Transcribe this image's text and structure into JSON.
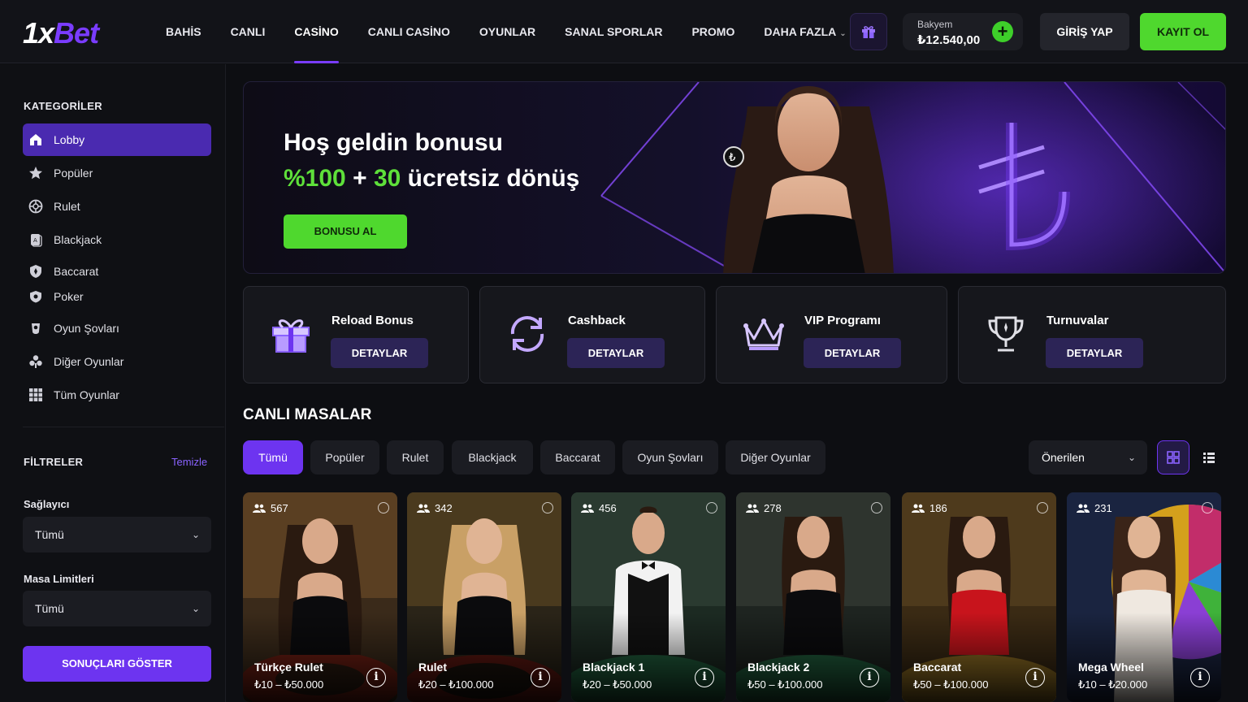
{
  "header": {
    "logo_part1": "1x",
    "logo_part2": "Bet",
    "nav": [
      {
        "label": "BAHİS"
      },
      {
        "label": "CANLI"
      },
      {
        "label": "CASİNO",
        "active": true
      },
      {
        "label": "CANLI CASİNO"
      },
      {
        "label": "OYUNLAR"
      },
      {
        "label": "SANAL SPORLAR"
      },
      {
        "label": "PROMO"
      },
      {
        "label": "DAHA FAZLA"
      }
    ],
    "balance_label": "Bakyem",
    "balance_value": "₺12.540,00",
    "balance_add": "+",
    "login_label": "GİRİŞ YAP",
    "register_label": "KAYIT OL"
  },
  "sidebar": {
    "categories_title": "KATEGORİLER",
    "categories": [
      {
        "label": "Lobby",
        "icon": "lobby-icon",
        "active": true
      },
      {
        "label": "Popüler",
        "icon": "star-icon"
      },
      {
        "label": "Rulet",
        "icon": "roulette-icon"
      },
      {
        "label": "Blackjack",
        "icon": "blackjack-icon"
      },
      {
        "label": "Baccarat",
        "icon": "baccarat-icon"
      },
      {
        "label": "Poker",
        "icon": "poker-icon"
      },
      {
        "label": "Oyun Şovları",
        "icon": "game-show-icon"
      },
      {
        "label": "Diğer Oyunlar",
        "icon": "other-games-icon"
      },
      {
        "label": "Tüm Oyunlar",
        "icon": "grid-icon"
      }
    ],
    "filters_title": "FİLTRELER",
    "clear_label": "Temizle",
    "provider_label": "Sağlayıcı",
    "provider_value": "Tümü",
    "limits_label": "Masa Limitleri",
    "limits_value": "Tümü",
    "show_results_label": "SONUÇLARI GÖSTER"
  },
  "banner": {
    "title": "Hoş geldin bonusu",
    "sub_percent": "%100",
    "sub_plus": " + ",
    "sub_spins": "30",
    "sub_rest": " ücretsiz dönüş",
    "button_label": "BONUSU AL",
    "currency_symbol": "₺"
  },
  "promos": [
    {
      "title": "Reload Bonus",
      "button": "DETAYLAR",
      "icon": "gift-icon"
    },
    {
      "title": "Cashback",
      "button": "DETAYLAR",
      "icon": "cashback-icon"
    },
    {
      "title": "VIP Programı",
      "button": "DETAYLAR",
      "icon": "crown-icon"
    },
    {
      "title": "Turnuvalar",
      "button": "DETAYLAR",
      "icon": "trophy-icon"
    }
  ],
  "live": {
    "title": "CANLI MASALAR",
    "chips": [
      {
        "label": "Tümü",
        "active": true
      },
      {
        "label": "Popüler"
      },
      {
        "label": "Rulet"
      },
      {
        "label": "Blackjack"
      },
      {
        "label": "Baccarat"
      },
      {
        "label": "Oyun Şovları"
      },
      {
        "label": "Diğer Oyunlar"
      }
    ],
    "sort_value": "Önerilen",
    "tables": [
      {
        "players": "567",
        "name": "Türkçe Rulet",
        "limits": "₺10 – ₺50.000",
        "info": "i"
      },
      {
        "players": "342",
        "name": "Rulet",
        "limits": "₺20 – ₺100.000",
        "info": "i"
      },
      {
        "players": "456",
        "name": "Blackjack 1",
        "limits": "₺20 – ₺50.000",
        "info": "i"
      },
      {
        "players": "278",
        "name": "Blackjack 2",
        "limits": "₺50 – ₺100.000",
        "info": "i"
      },
      {
        "players": "186",
        "name": "Baccarat",
        "limits": "₺50 – ₺100.000",
        "info": "i"
      },
      {
        "players": "231",
        "name": "Mega Wheel",
        "limits": "₺10 – ₺20.000",
        "info": "i"
      }
    ]
  },
  "colors": {
    "accent_purple": "#6d34f0",
    "accent_green": "#4fd82e",
    "background": "#0d0e12"
  }
}
